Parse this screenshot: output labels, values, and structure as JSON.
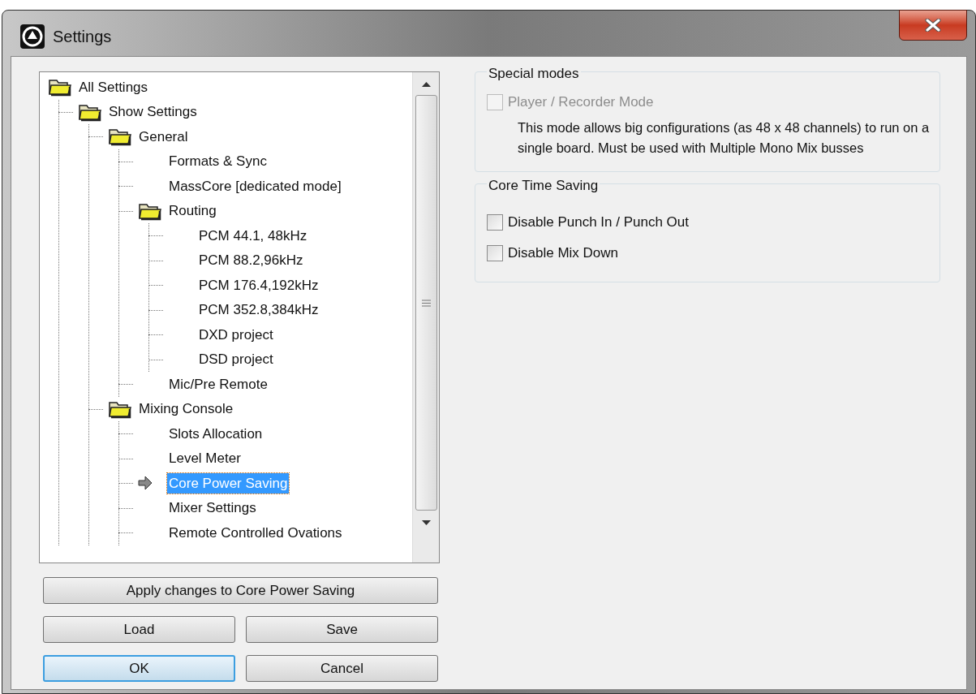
{
  "window": {
    "title": "Settings"
  },
  "tree": [
    {
      "label": "All Settings",
      "selected": false,
      "children": [
        {
          "label": "Show Settings",
          "selected": false,
          "children": [
            {
              "label": "General",
              "selected": false,
              "children": [
                {
                  "label": "Formats & Sync",
                  "selected": false
                },
                {
                  "label": "MassCore [dedicated mode]",
                  "selected": false
                },
                {
                  "label": "Routing",
                  "selected": false,
                  "children": [
                    {
                      "label": "PCM 44.1, 48kHz",
                      "selected": false
                    },
                    {
                      "label": "PCM 88.2,96kHz",
                      "selected": false
                    },
                    {
                      "label": "PCM 176.4,192kHz",
                      "selected": false
                    },
                    {
                      "label": "PCM 352.8,384kHz",
                      "selected": false
                    },
                    {
                      "label": "DXD project",
                      "selected": false
                    },
                    {
                      "label": "DSD project",
                      "selected": false
                    }
                  ]
                },
                {
                  "label": "Mic/Pre Remote",
                  "selected": false
                }
              ]
            },
            {
              "label": "Mixing Console",
              "selected": false,
              "children": [
                {
                  "label": "Slots Allocation",
                  "selected": false
                },
                {
                  "label": "Level Meter",
                  "selected": false
                },
                {
                  "label": "Core Power Saving",
                  "selected": true
                },
                {
                  "label": "Mixer Settings",
                  "selected": false
                },
                {
                  "label": "Remote Controlled Ovations",
                  "selected": false
                }
              ]
            }
          ]
        }
      ]
    }
  ],
  "apply_button": "Apply changes to Core Power Saving",
  "buttons": [
    {
      "label": "Load",
      "default": false
    },
    {
      "label": "Save",
      "default": false
    },
    {
      "label": "OK",
      "default": true
    },
    {
      "label": "Cancel",
      "default": false
    }
  ],
  "groups": [
    {
      "title": "Special modes",
      "options": [
        {
          "label": "Player / Recorder Mode",
          "checked": false,
          "disabled": true
        }
      ],
      "note": "This mode allows big configurations (as 48 x 48 channels) to run on a single board. Must be used with Multiple Mono Mix busses"
    },
    {
      "title": "Core Time Saving",
      "options": [
        {
          "label": "Disable Punch In / Punch Out",
          "checked": false,
          "disabled": false
        },
        {
          "label": "Disable Mix Down",
          "checked": false,
          "disabled": false
        }
      ]
    }
  ]
}
